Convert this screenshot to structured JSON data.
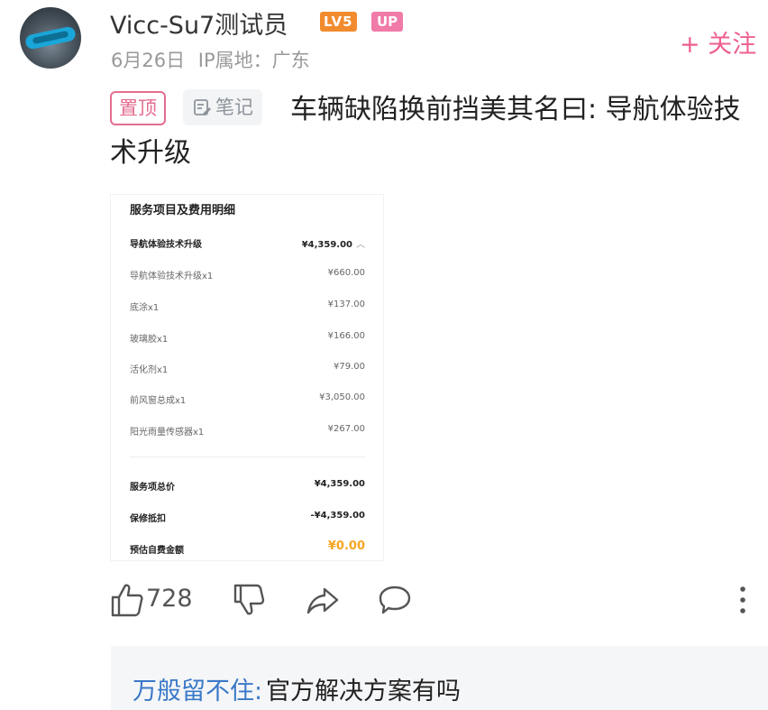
{
  "post": {
    "author": {
      "name": "Vicc-Su7测试员",
      "level_badge": "LV5",
      "up_badge": "UP",
      "date": "6月26日",
      "ip_location": "IP属地：广东"
    },
    "follow_label": "+ 关注",
    "pin_tag": "置顶",
    "note_tag": "笔记",
    "title": "车辆缺陷换前挡美其名曰: 导航体验技术升级",
    "receipt": {
      "heading": "服务项目及费用明细",
      "main_item": {
        "label": "导航体验技术升级",
        "value": "¥4,359.00"
      },
      "items": [
        {
          "label": "导航体验技术升级x1",
          "value": "¥660.00"
        },
        {
          "label": "底涂x1",
          "value": "¥137.00"
        },
        {
          "label": "玻璃胶x1",
          "value": "¥166.00"
        },
        {
          "label": "活化剂x1",
          "value": "¥79.00"
        },
        {
          "label": "前风窗总成x1",
          "value": "¥3,050.00"
        },
        {
          "label": "阳光雨量传感器x1",
          "value": "¥267.00"
        }
      ],
      "summary": [
        {
          "label": "服务项总价",
          "value": "¥4,359.00"
        },
        {
          "label": "保修抵扣",
          "value": "-¥4,359.00"
        },
        {
          "label": "预估自费金额",
          "value": "¥0.00"
        }
      ]
    },
    "actions": {
      "like_count": "728",
      "icons": [
        "thumbs-up-icon",
        "thumbs-down-icon",
        "share-icon",
        "comment-icon",
        "more-icon"
      ]
    }
  },
  "comment": {
    "author": "万般留不住",
    "separator": ":",
    "text": "官方解决方案有吗"
  },
  "colors": {
    "accent_pink": "#ee5f8f",
    "level_orange": "#f28b2e",
    "link_blue": "#3a79c7",
    "amount_orange": "#f5a623"
  }
}
